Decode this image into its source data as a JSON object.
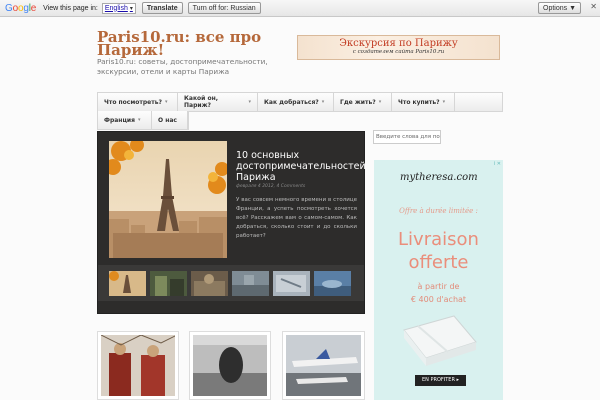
{
  "translate_bar": {
    "logo": "Google",
    "prompt": "View this page in:",
    "language": "English",
    "translate_label": "Translate",
    "turn_off_label": "Turn off for: Russian",
    "options_label": "Options ▼",
    "close_label": "✕"
  },
  "header": {
    "title": "Paris10.ru: все про Париж!",
    "description": "Paris10.ru: советы, достопримечательности, экскурсии, отели и карты Парижа"
  },
  "banner": {
    "title": "Экскурсия по Парижу",
    "subtitle": "с создателем сайта Paris10.ru"
  },
  "nav": {
    "row1": [
      {
        "label": "Что посмотреть?",
        "dropdown": true
      },
      {
        "label": "Какой он, Париж?",
        "dropdown": true
      },
      {
        "label": "Как добраться?",
        "dropdown": true
      },
      {
        "label": "Где жить?",
        "dropdown": true
      },
      {
        "label": "Что купить?",
        "dropdown": true
      }
    ],
    "row2": [
      {
        "label": "Франция",
        "dropdown": true
      },
      {
        "label": "О нас",
        "dropdown": false
      }
    ]
  },
  "featured": {
    "title": "10 основных достопримечательностей Парижа",
    "meta": "февраля 4 2012, 4 Comments",
    "excerpt": "У вас совсем немного времени в столице Франции, а успеть посмотреть хочется всё? Расскажем вам о самом-самом. Как добраться, сколько стоит и до скольки работает?"
  },
  "search": {
    "placeholder": "Введите слова для по"
  },
  "ad": {
    "logo": "mytheresa.com",
    "offer": "Offre à durée limitée :",
    "headline_1": "Livraison",
    "headline_2": "offerte",
    "sub_1": "à partir de",
    "sub_2": "€ 400 d'achat",
    "cta": "EN PROFITER ▸",
    "info": "i ✕"
  },
  "colors": {
    "title_brown": "#b5683a",
    "banner_red": "#c23b22",
    "featured_bg": "#2d2c2b",
    "ad_bg": "#d9f1ef",
    "ad_coral": "#ea8e7b"
  }
}
